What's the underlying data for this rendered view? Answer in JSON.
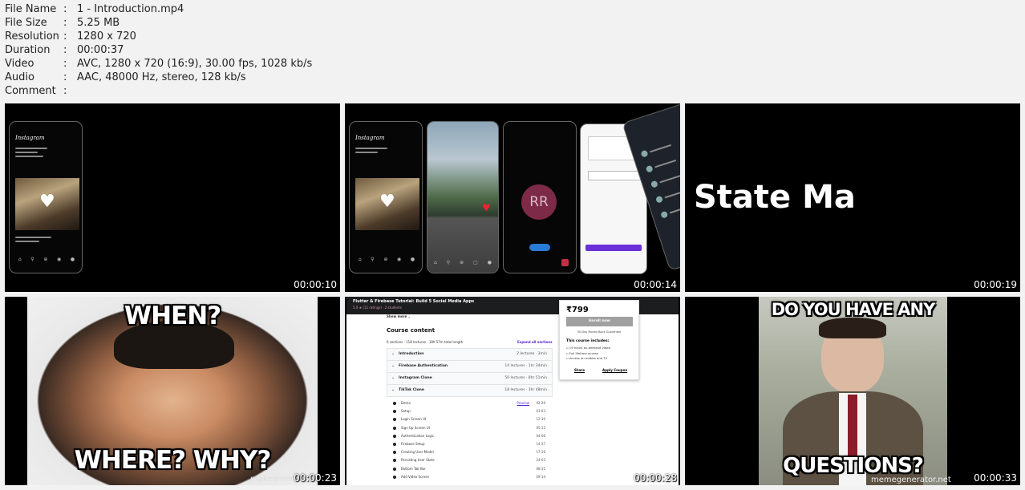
{
  "metadata": [
    {
      "key": "File Name",
      "value": "1 - Introduction.mp4"
    },
    {
      "key": "File Size",
      "value": "5.25 MB"
    },
    {
      "key": "Resolution",
      "value": "1280 x 720"
    },
    {
      "key": "Duration",
      "value": "00:00:37"
    },
    {
      "key": "Video",
      "value": "AVC, 1280 x 720 (16:9), 30.00 fps, 1028 kb/s"
    },
    {
      "key": "Audio",
      "value": "AAC, 48000 Hz, stereo, 128 kb/s"
    },
    {
      "key": "Comment",
      "value": ""
    }
  ],
  "separator": ":",
  "thumbnails": [
    {
      "timestamp": "00:00:10",
      "scene": "instagram-clone"
    },
    {
      "timestamp": "00:00:14",
      "scene": "app-showcase"
    },
    {
      "timestamp": "00:00:19",
      "scene": "state-management-title"
    },
    {
      "timestamp": "00:00:23",
      "scene": "meme-confused"
    },
    {
      "timestamp": "00:00:28",
      "scene": "course-page"
    },
    {
      "timestamp": "00:00:33",
      "scene": "meme-questions"
    }
  ],
  "scene_text": {
    "instagram_brand": "Instagram",
    "avatar_initials": "RR",
    "state_title": "State Ma",
    "meme1_top": "WHEN?",
    "meme1_bottom": "WHERE? WHY?",
    "meme1_watermark": "makeameme",
    "meme2_top": "DO YOU HAVE ANY",
    "meme2_bottom": "QUESTIONS?",
    "meme2_watermark": "memegenerator.net"
  },
  "course": {
    "title": "Flutter & Firebase Tutorial: Build 5 Social Media Apps",
    "subtitle": "5.0 ★ (11 ratings) · 2 students",
    "show_more": "Show more ⌄",
    "content_heading": "Course content",
    "summary": "6 sections · 118 lectures · 18h 57m total length",
    "expand_all": "Expand all sections",
    "sections": [
      {
        "title": "Introduction",
        "info": "2 lectures · 3min"
      },
      {
        "title": "Firebase Authentication",
        "info": "14 lectures · 1hr 34min"
      },
      {
        "title": "Instagram Clone",
        "info": "50 lectures · 8hr 51min"
      },
      {
        "title": "TikTok Clone",
        "info": "18 lectures · 3hr 48min"
      }
    ],
    "lectures": [
      {
        "title": "Demo",
        "duration": "02:26",
        "preview": "Preview"
      },
      {
        "title": "Setup",
        "duration": "03:03"
      },
      {
        "title": "Login Screen UI",
        "duration": "12:10"
      },
      {
        "title": "Sign Up Screen UI",
        "duration": "05:15"
      },
      {
        "title": "Authentication Logic",
        "duration": "04:06"
      },
      {
        "title": "Firebase Setup",
        "duration": "14:37"
      },
      {
        "title": "Creating User Model",
        "duration": "17:16"
      },
      {
        "title": "Persisting User State",
        "duration": "24:03"
      },
      {
        "title": "Bottom Tab Bar",
        "duration": "08:35"
      },
      {
        "title": "Add Video Screen",
        "duration": "09:14"
      }
    ],
    "price": "₹799",
    "enroll": "Enroll now",
    "guarantee": "30-Day Money-Back Guarantee",
    "includes_heading": "This course includes:",
    "includes": [
      "19 hours on-demand video",
      "Full lifetime access",
      "Access on mobile and TV"
    ],
    "share": "Share",
    "coupon": "Apply Coupon"
  }
}
